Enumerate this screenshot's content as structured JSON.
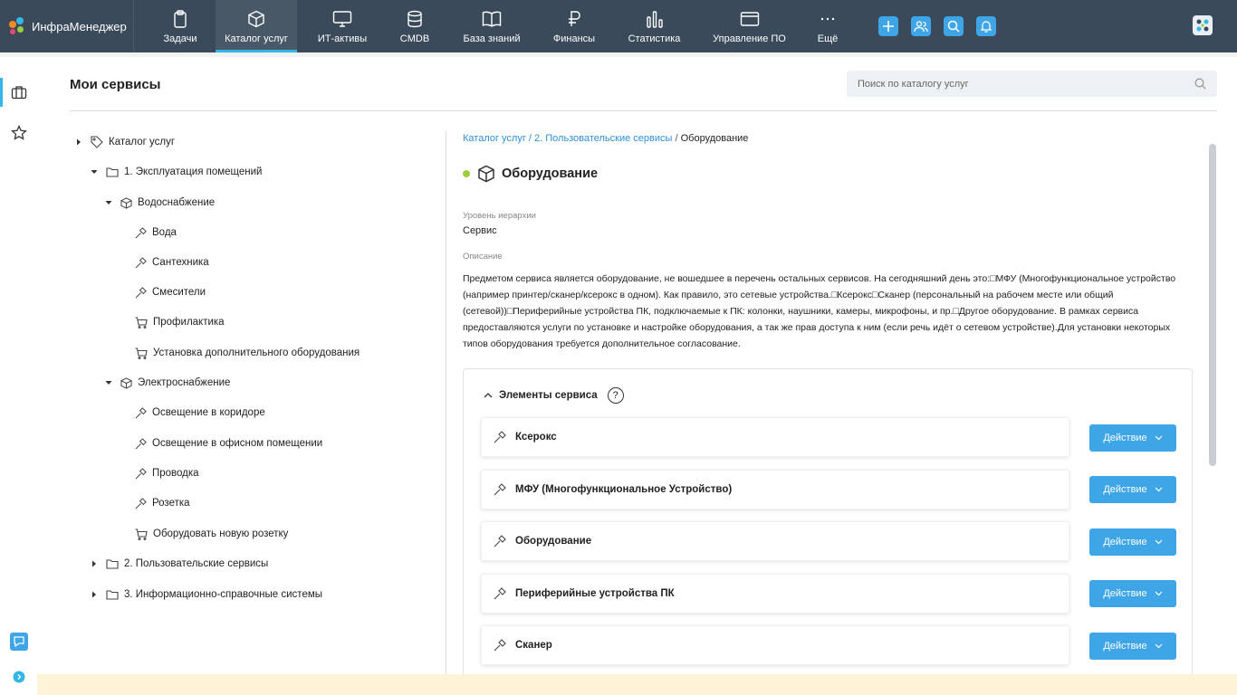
{
  "app": {
    "brand": "ИнфраМенеджер"
  },
  "nav": [
    {
      "key": "tasks",
      "label": "Задачи",
      "icon": "clipboard-icon"
    },
    {
      "key": "catalog",
      "label": "Каталог услуг",
      "icon": "cube-icon",
      "active": true
    },
    {
      "key": "it-assets",
      "label": "ИТ-активы",
      "icon": "monitor-icon"
    },
    {
      "key": "cmdb",
      "label": "CMDB",
      "icon": "database-icon"
    },
    {
      "key": "kb",
      "label": "База знаний",
      "icon": "book-icon"
    },
    {
      "key": "finance",
      "label": "Финансы",
      "icon": "ruble-icon"
    },
    {
      "key": "stats",
      "label": "Статистика",
      "icon": "bar-chart-icon"
    },
    {
      "key": "software",
      "label": "Управление ПО",
      "icon": "window-icon"
    },
    {
      "key": "more",
      "label": "Ещё",
      "icon": "more-dots-icon"
    }
  ],
  "top_actions": [
    "add-icon",
    "users-icon",
    "search-icon",
    "bell-icon"
  ],
  "page": {
    "title": "Мои сервисы"
  },
  "search": {
    "placeholder": "Поиск по каталогу услуг",
    "value": ""
  },
  "tree": {
    "root": "Каталог услуг",
    "n1": "1. Эксплуатация помещений",
    "n1_1": "Водоснабжение",
    "n1_1_1": "Вода",
    "n1_1_2": "Сантехника",
    "n1_1_3": "Смесители",
    "n1_1_4": "Профилактика",
    "n1_1_5": "Установка дополнительного оборудования",
    "n1_2": "Электроснабжение",
    "n1_2_1": "Освещение в коридоре",
    "n1_2_2": "Освещение в офисном помещении",
    "n1_2_3": "Проводка",
    "n1_2_4": "Розетка",
    "n1_2_5": "Оборудовать новую розетку",
    "n2": "2. Пользовательские сервисы",
    "n3": "3. Информационно-справочные системы"
  },
  "breadcrumb": {
    "c1": "Каталог услуг",
    "sep": "/",
    "c2": "2. Пользовательские сервисы",
    "current": "Оборудование"
  },
  "service": {
    "title": "Оборудование",
    "status_color": "#9dcc3d",
    "level_label": "Уровень иерархии",
    "level_value": "Сервис",
    "desc_label": "Описание",
    "description": "Предметом сервиса является оборудование, не вошедшее в перечень остальных сервисов. На сегодняшний день это:□МФУ (Многофункциональное устройство (например принтер/сканер/ксерокс в одном). Как правило, это сетевые устройства.□Ксерокс□Сканер (персональный на рабочем месте или общий (сетевой))□Периферийные устройства ПК, подключаемые к ПК: колонки, наушники, камеры, микрофоны, и пр.□Другое оборудование. В рамках сервиса предоставляются услуги по установке и настройке оборудования, а так же прав доступа к ним (если речь идёт о сетевом устройстве).Для установки некоторых типов оборудования требуется дополнительное согласование."
  },
  "elements": {
    "header": "Элементы сервиса",
    "help": "?",
    "action_label": "Действие",
    "items": [
      "Ксерокс",
      "МФУ (Многофункциональное Устройство)",
      "Оборудование",
      "Периферийные устройства ПК",
      "Сканер"
    ]
  },
  "colors": {
    "topbar": "#3a4a5a",
    "accent": "#35b6e8",
    "button": "#3ea5e6",
    "link": "#2f8fd6"
  }
}
